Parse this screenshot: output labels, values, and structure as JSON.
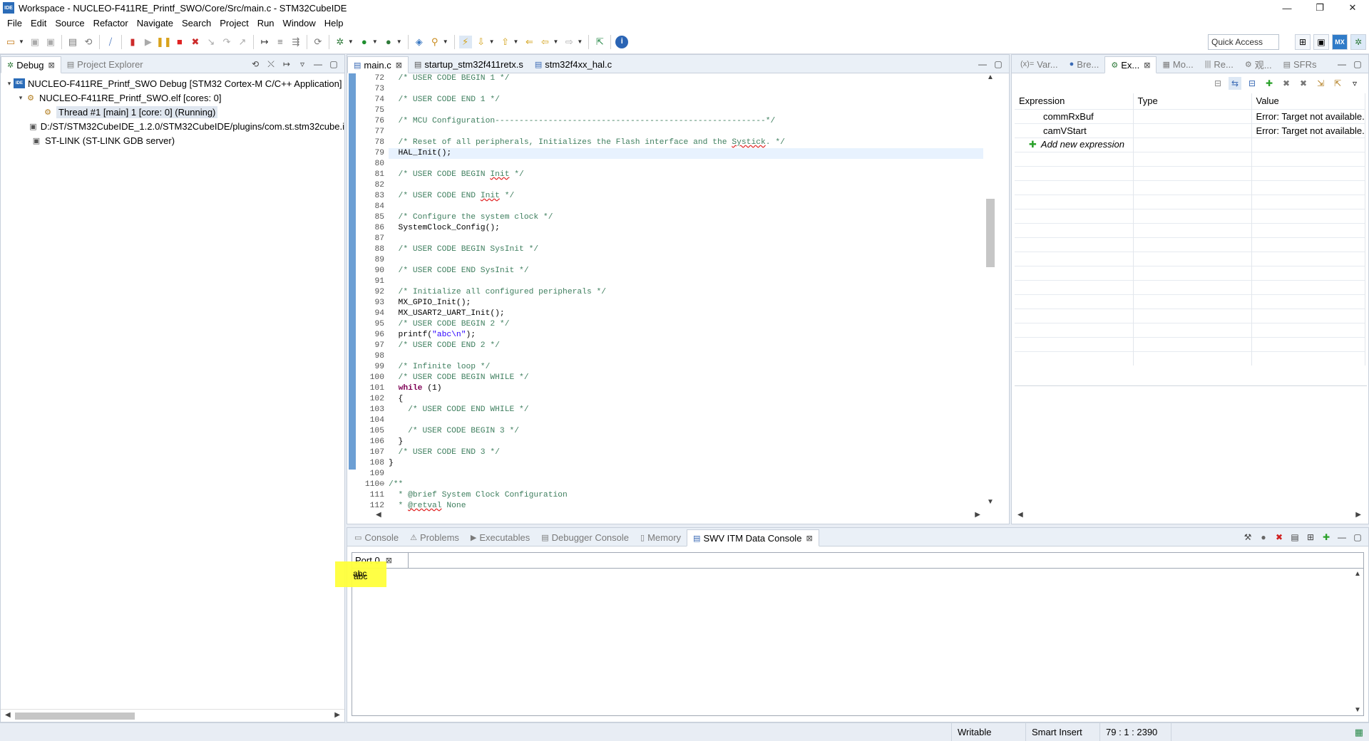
{
  "window": {
    "title": "Workspace - NUCLEO-F411RE_Printf_SWO/Core/Src/main.c - STM32CubeIDE",
    "app_icon": "IDE",
    "controls": [
      "—",
      "❐",
      "✕"
    ]
  },
  "menu": [
    "File",
    "Edit",
    "Source",
    "Refactor",
    "Navigate",
    "Search",
    "Project",
    "Run",
    "Window",
    "Help"
  ],
  "toolbar": {
    "quick_access": "Quick Access",
    "mx_label": "MX"
  },
  "debug_panel": {
    "tabs": [
      {
        "label": "Debug",
        "active": true
      },
      {
        "label": "Project Explorer",
        "active": false
      }
    ],
    "tree": [
      {
        "level": 0,
        "twisty": "▾",
        "icon": "IDE",
        "label": "NUCLEO-F411RE_Printf_SWO Debug [STM32 Cortex-M C/C++ Application]"
      },
      {
        "level": 1,
        "twisty": "▾",
        "icon": "⚙",
        "label": "NUCLEO-F411RE_Printf_SWO.elf [cores: 0]"
      },
      {
        "level": 2,
        "twisty": "",
        "icon": "⚙",
        "label": "Thread #1 [main] 1 [core: 0] (Running)",
        "selected": true
      },
      {
        "level": 1,
        "twisty": "",
        "icon": "▣",
        "label": "D:/ST/STM32CubeIDE_1.2.0/STM32CubeIDE/plugins/com.st.stm32cube.i"
      },
      {
        "level": 1,
        "twisty": "",
        "icon": "▣",
        "label": "ST-LINK (ST-LINK GDB server)"
      }
    ]
  },
  "editor": {
    "tabs": [
      {
        "label": "main.c",
        "active": true,
        "icon": "c-file"
      },
      {
        "label": "startup_stm32f411retx.s",
        "active": false,
        "icon": "asm-file"
      },
      {
        "label": "stm32f4xx_hal.c",
        "active": false,
        "icon": "c-file"
      }
    ],
    "current_line": 79,
    "lines": [
      {
        "n": "72",
        "c": [
          {
            "t": "  /* USER CODE BEGIN 1 */",
            "k": "cm"
          }
        ]
      },
      {
        "n": "73",
        "c": []
      },
      {
        "n": "74",
        "c": [
          {
            "t": "  /* USER CODE END 1 */",
            "k": "cm"
          }
        ]
      },
      {
        "n": "75",
        "c": []
      },
      {
        "n": "76",
        "c": [
          {
            "t": "  /* MCU Configuration--------------------------------------------------------*/",
            "k": "cm"
          }
        ]
      },
      {
        "n": "77",
        "c": []
      },
      {
        "n": "78",
        "c": [
          {
            "t": "  /* Reset of all peripherals, Initializes the Flash interface and the ",
            "k": "cm"
          },
          {
            "t": "Systick",
            "k": "cm err"
          },
          {
            "t": ". */",
            "k": "cm"
          }
        ]
      },
      {
        "n": "79",
        "c": [
          {
            "t": "  HAL_Init();",
            "k": ""
          }
        ]
      },
      {
        "n": "80",
        "c": []
      },
      {
        "n": "81",
        "c": [
          {
            "t": "  /* USER CODE BEGIN ",
            "k": "cm"
          },
          {
            "t": "Init",
            "k": "cm err"
          },
          {
            "t": " */",
            "k": "cm"
          }
        ]
      },
      {
        "n": "82",
        "c": []
      },
      {
        "n": "83",
        "c": [
          {
            "t": "  /* USER CODE END ",
            "k": "cm"
          },
          {
            "t": "Init",
            "k": "cm err"
          },
          {
            "t": " */",
            "k": "cm"
          }
        ]
      },
      {
        "n": "84",
        "c": []
      },
      {
        "n": "85",
        "c": [
          {
            "t": "  /* Configure the system clock */",
            "k": "cm"
          }
        ]
      },
      {
        "n": "86",
        "c": [
          {
            "t": "  SystemClock_Config();",
            "k": ""
          }
        ]
      },
      {
        "n": "87",
        "c": []
      },
      {
        "n": "88",
        "c": [
          {
            "t": "  /* USER CODE BEGIN SysInit */",
            "k": "cm"
          }
        ]
      },
      {
        "n": "89",
        "c": []
      },
      {
        "n": "90",
        "c": [
          {
            "t": "  /* USER CODE END SysInit */",
            "k": "cm"
          }
        ]
      },
      {
        "n": "91",
        "c": []
      },
      {
        "n": "92",
        "c": [
          {
            "t": "  /* Initialize all configured peripherals */",
            "k": "cm"
          }
        ]
      },
      {
        "n": "93",
        "c": [
          {
            "t": "  MX_GPIO_Init();",
            "k": ""
          }
        ]
      },
      {
        "n": "94",
        "c": [
          {
            "t": "  MX_USART2_UART_Init();",
            "k": ""
          }
        ]
      },
      {
        "n": "95",
        "c": [
          {
            "t": "  /* USER CODE BEGIN 2 */",
            "k": "cm"
          }
        ]
      },
      {
        "n": "96",
        "c": [
          {
            "t": "  printf(",
            "k": ""
          },
          {
            "t": "\"abc\\n\"",
            "k": "st"
          },
          {
            "t": ");",
            "k": ""
          }
        ]
      },
      {
        "n": "97",
        "c": [
          {
            "t": "  /* USER CODE END 2 */",
            "k": "cm"
          }
        ]
      },
      {
        "n": "98",
        "c": []
      },
      {
        "n": "99",
        "c": [
          {
            "t": "  /* Infinite loop */",
            "k": "cm"
          }
        ]
      },
      {
        "n": "100",
        "c": [
          {
            "t": "  /* USER CODE BEGIN WHILE */",
            "k": "cm"
          }
        ]
      },
      {
        "n": "101",
        "c": [
          {
            "t": "  ",
            "k": ""
          },
          {
            "t": "while",
            "k": "kw"
          },
          {
            "t": " (1)",
            "k": ""
          }
        ]
      },
      {
        "n": "102",
        "c": [
          {
            "t": "  {",
            "k": ""
          }
        ]
      },
      {
        "n": "103",
        "c": [
          {
            "t": "    /* USER CODE END WHILE */",
            "k": "cm"
          }
        ]
      },
      {
        "n": "104",
        "c": []
      },
      {
        "n": "105",
        "c": [
          {
            "t": "    /* USER CODE BEGIN 3 */",
            "k": "cm"
          }
        ]
      },
      {
        "n": "106",
        "c": [
          {
            "t": "  }",
            "k": ""
          }
        ]
      },
      {
        "n": "107",
        "c": [
          {
            "t": "  /* USER CODE END 3 */",
            "k": "cm"
          }
        ]
      },
      {
        "n": "108",
        "c": [
          {
            "t": "}",
            "k": ""
          }
        ]
      },
      {
        "n": "109",
        "c": []
      },
      {
        "n": "110⊖",
        "c": [
          {
            "t": "/**",
            "k": "cm"
          }
        ]
      },
      {
        "n": "111",
        "c": [
          {
            "t": "  * @brief System Clock Configuration",
            "k": "cm"
          }
        ]
      },
      {
        "n": "112",
        "c": [
          {
            "t": "  * ",
            "k": "cm"
          },
          {
            "t": "@retval",
            "k": "cm err"
          },
          {
            "t": " None",
            "k": "cm"
          }
        ]
      }
    ]
  },
  "expressions": {
    "tabs": [
      {
        "label": "Var...",
        "icon": "(x)=",
        "active": false
      },
      {
        "label": "Bre...",
        "icon": "●",
        "active": false
      },
      {
        "label": "Ex...",
        "icon": "⚙",
        "active": true
      },
      {
        "label": "Mo...",
        "icon": "▦",
        "active": false
      },
      {
        "label": "Re...",
        "icon": "|||",
        "active": false
      },
      {
        "label": "观...",
        "icon": "⚙",
        "active": false
      },
      {
        "label": "SFRs",
        "icon": "▤",
        "active": false
      }
    ],
    "columns": [
      "Expression",
      "Type",
      "Value"
    ],
    "rows": [
      {
        "expression": "commRxBuf",
        "type": "",
        "value": "Error: Target not available."
      },
      {
        "expression": "camVStart",
        "type": "",
        "value": "Error: Target not available."
      }
    ],
    "add_label": "Add new expression"
  },
  "console": {
    "tabs": [
      {
        "label": "Console",
        "icon": "▭",
        "active": false
      },
      {
        "label": "Problems",
        "icon": "⚠",
        "active": false
      },
      {
        "label": "Executables",
        "icon": "▶",
        "active": false
      },
      {
        "label": "Debugger Console",
        "icon": "▤",
        "active": false
      },
      {
        "label": "Memory",
        "icon": "▯",
        "active": false
      },
      {
        "label": "SWV ITM Data Console",
        "icon": "▤",
        "active": true
      }
    ],
    "port_tab": "Port 0",
    "output": "abc",
    "highlight_color": "#ffff3b"
  },
  "status": {
    "writable": "Writable",
    "insert_mode": "Smart Insert",
    "position": "79 : 1 : 2390"
  },
  "colors": {
    "comment": "#3f7f5f",
    "keyword": "#7f0055",
    "string": "#2a00ff",
    "current_line": "#e8f2fe",
    "ruler": "#6c9fd4"
  }
}
